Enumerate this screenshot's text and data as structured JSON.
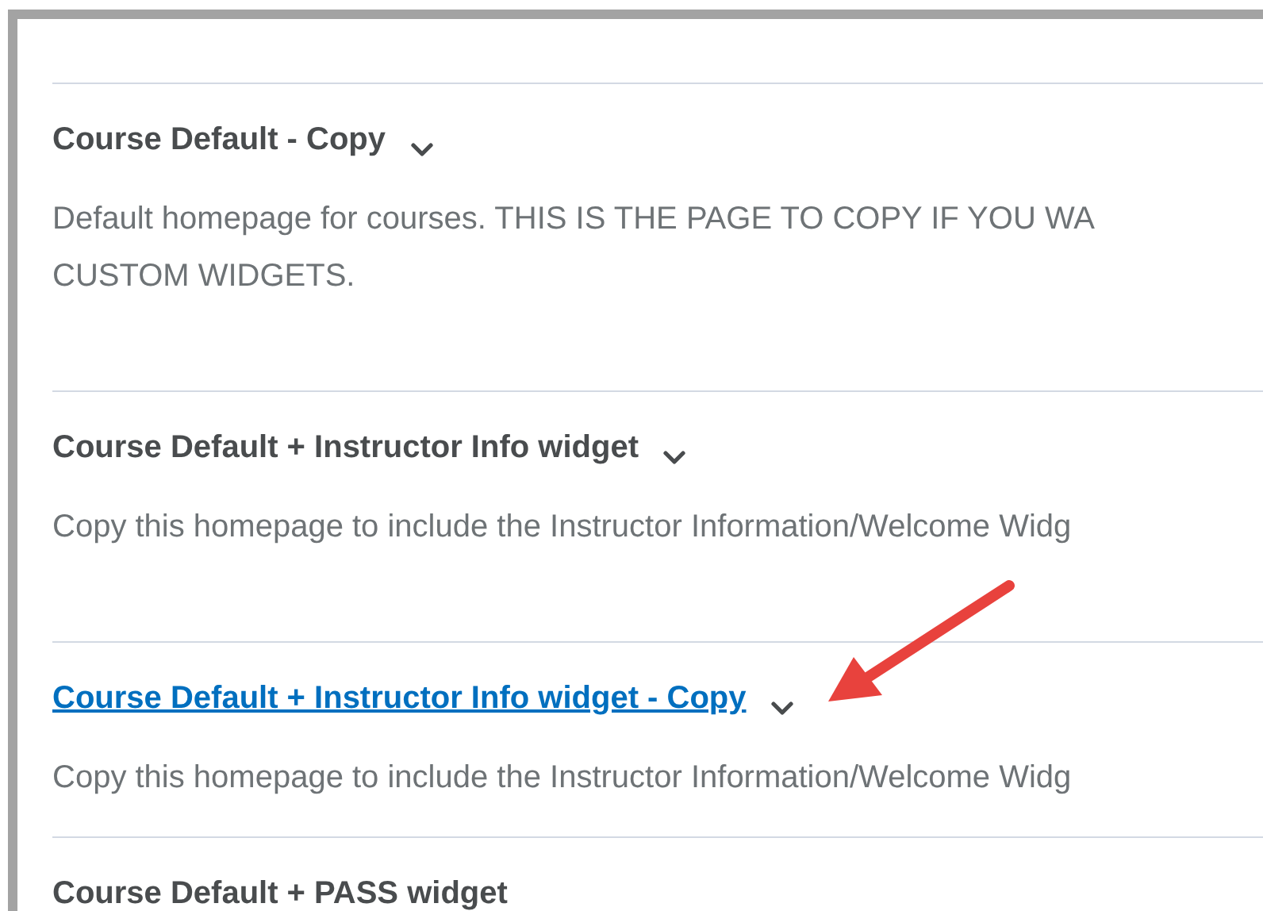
{
  "homepages": [
    {
      "title": "Course Default - Copy",
      "kind": "plain",
      "description": [
        "Default homepage for courses. THIS IS THE PAGE TO COPY IF YOU WA",
        "CUSTOM WIDGETS."
      ]
    },
    {
      "title": "Course Default + Instructor Info widget",
      "kind": "plain",
      "description": [
        "Copy this homepage to include the Instructor Information/Welcome Widg"
      ]
    },
    {
      "title": "Course Default + Instructor Info widget - Copy",
      "kind": "link",
      "description": [
        "Copy this homepage to include the Instructor Information/Welcome Widg"
      ]
    },
    {
      "title": "Course Default + PASS widget",
      "kind": "plain"
    }
  ]
}
